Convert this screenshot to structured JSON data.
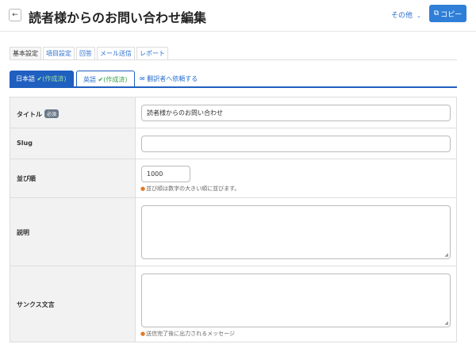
{
  "header": {
    "back_icon": "arrow-left-icon",
    "title": "読者様からのお問い合わせ編集",
    "more_label": "その他",
    "copy_label": "コピー"
  },
  "main_tabs": [
    "基本設定",
    "項目設定",
    "回答",
    "メール送信",
    "レポート"
  ],
  "lang_tabs": {
    "ja": {
      "label": "日本語",
      "status": "(作成済)"
    },
    "en": {
      "label": "英語",
      "status": "(作成済)"
    },
    "request": {
      "label": "翻訳者へ依頼する"
    }
  },
  "form": {
    "title": {
      "label": "タイトル",
      "badge": "必須",
      "value": "読者様からのお問い合わせ"
    },
    "slug": {
      "label": "Slug",
      "value": ""
    },
    "order": {
      "label": "並び順",
      "value": "1000",
      "hint": "並び順は数字の大きい順に並びます。"
    },
    "description": {
      "label": "説明",
      "value": ""
    },
    "thanks": {
      "label": "サンクス文言",
      "value": "",
      "hint": "送信完了後に出力されるメッセージ"
    }
  }
}
